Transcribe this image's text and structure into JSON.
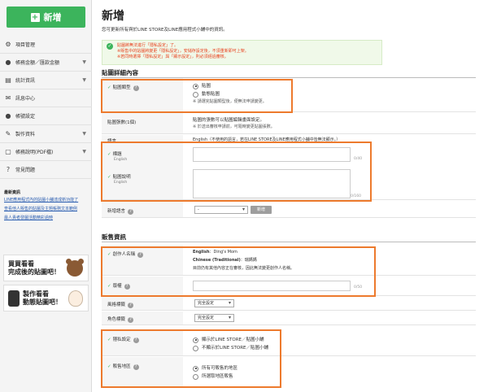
{
  "sidebar": {
    "new_button": "新增",
    "nav": [
      {
        "label": "項目管理",
        "icon": "gear-icon",
        "expandable": false
      },
      {
        "label": "帳務金額／匯款金額",
        "icon": "coin-icon",
        "expandable": true
      },
      {
        "label": "統計資訊",
        "icon": "chart-icon",
        "expandable": true
      },
      {
        "label": "訊息中心",
        "icon": "message-icon",
        "expandable": false
      },
      {
        "label": "帳號設定",
        "icon": "user-icon",
        "expandable": false
      },
      {
        "label": "製作資料",
        "icon": "tools-icon",
        "expandable": true
      },
      {
        "label": "帳務說明(PDF檔)",
        "icon": "document-icon",
        "expandable": true
      },
      {
        "label": "常見問題",
        "icon": "help-icon",
        "expandable": false
      }
    ],
    "help_title": "最新資訊",
    "help_links": [
      "LINE應用程式內的貼圖小舖達成新功能了",
      "查看他人販售的貼圖及主題帳務文本範例",
      "最人責者發圖活動精彩過時"
    ],
    "banner1": [
      "買買看看",
      "完成後的貼圖吧！"
    ],
    "banner2": [
      "製作看看",
      "動態貼圖吧！"
    ]
  },
  "main": {
    "title": "新增",
    "subtitle": "您可更新所有與於LINE STORE及LINE應用程式小舖中的資訊。",
    "notice": [
      "貼圖將無法進行「隱私設定」了。",
      "※販售中的貼圖將變更「隱私設定」，安儲存設定後，不須重新即可上架。",
      "※若同時選擇「隱私設定」與「顯示設定」，則必須經過審核。"
    ],
    "section1": "貼圖詳細內容",
    "sticker_type": {
      "label": "貼圖類型",
      "options": [
        "貼圖",
        "動態貼圖"
      ],
      "selected": 0,
      "note": "※ 請選完貼圖類型後，便無法申請變更。"
    },
    "sticker_count": {
      "label": "貼圖張數(1個)",
      "lines": [
        "貼圖的張數可以貼圖編輯畫面設定。",
        "※ 於送出審核申請前，可隨時變更貼圖張數。"
      ]
    },
    "language": {
      "label": "語言",
      "text": "English（不使用的語言，若在LINE STORE及LINE應用程式小舖中皆無法顯示。）"
    },
    "title_field": {
      "label": "標題",
      "sublabel": "English",
      "count": "0/40"
    },
    "desc_field": {
      "label": "貼圖說明",
      "sublabel": "English",
      "count": "0/160"
    },
    "add_language": {
      "label": "新增語言",
      "select": "-",
      "button": "新增"
    },
    "section2": "販售資訊",
    "creator": {
      "label": "創作人名稱",
      "line1_lang": "English",
      "line1_val": "：Ding's Mom",
      "line2_lang": "Chinese (Traditional)",
      "line2_val": "：瑞媽媽",
      "note": "目前仍有其他內容正在審核，因此無法變更創作人名稱。"
    },
    "copyright": {
      "label": "版權",
      "count": "0/50"
    },
    "style_tag": {
      "label": "風格標籤",
      "select": "完全設定"
    },
    "character_tag": {
      "label": "角色標籤",
      "select": "完全設定"
    },
    "privacy": {
      "label": "隱私設定",
      "options": [
        "顯示於LINE STORE／貼圖小舖",
        "不顯示於LINE STORE／貼圖小舖"
      ],
      "selected": 0
    },
    "region": {
      "label": "販售地區",
      "options": [
        "所有可販售的地區",
        "所選取地區販售"
      ],
      "selected": 0
    }
  },
  "colors": {
    "accent": "#3cb45c",
    "highlight": "#ed7a2d",
    "notice_text": "#e8421f"
  }
}
